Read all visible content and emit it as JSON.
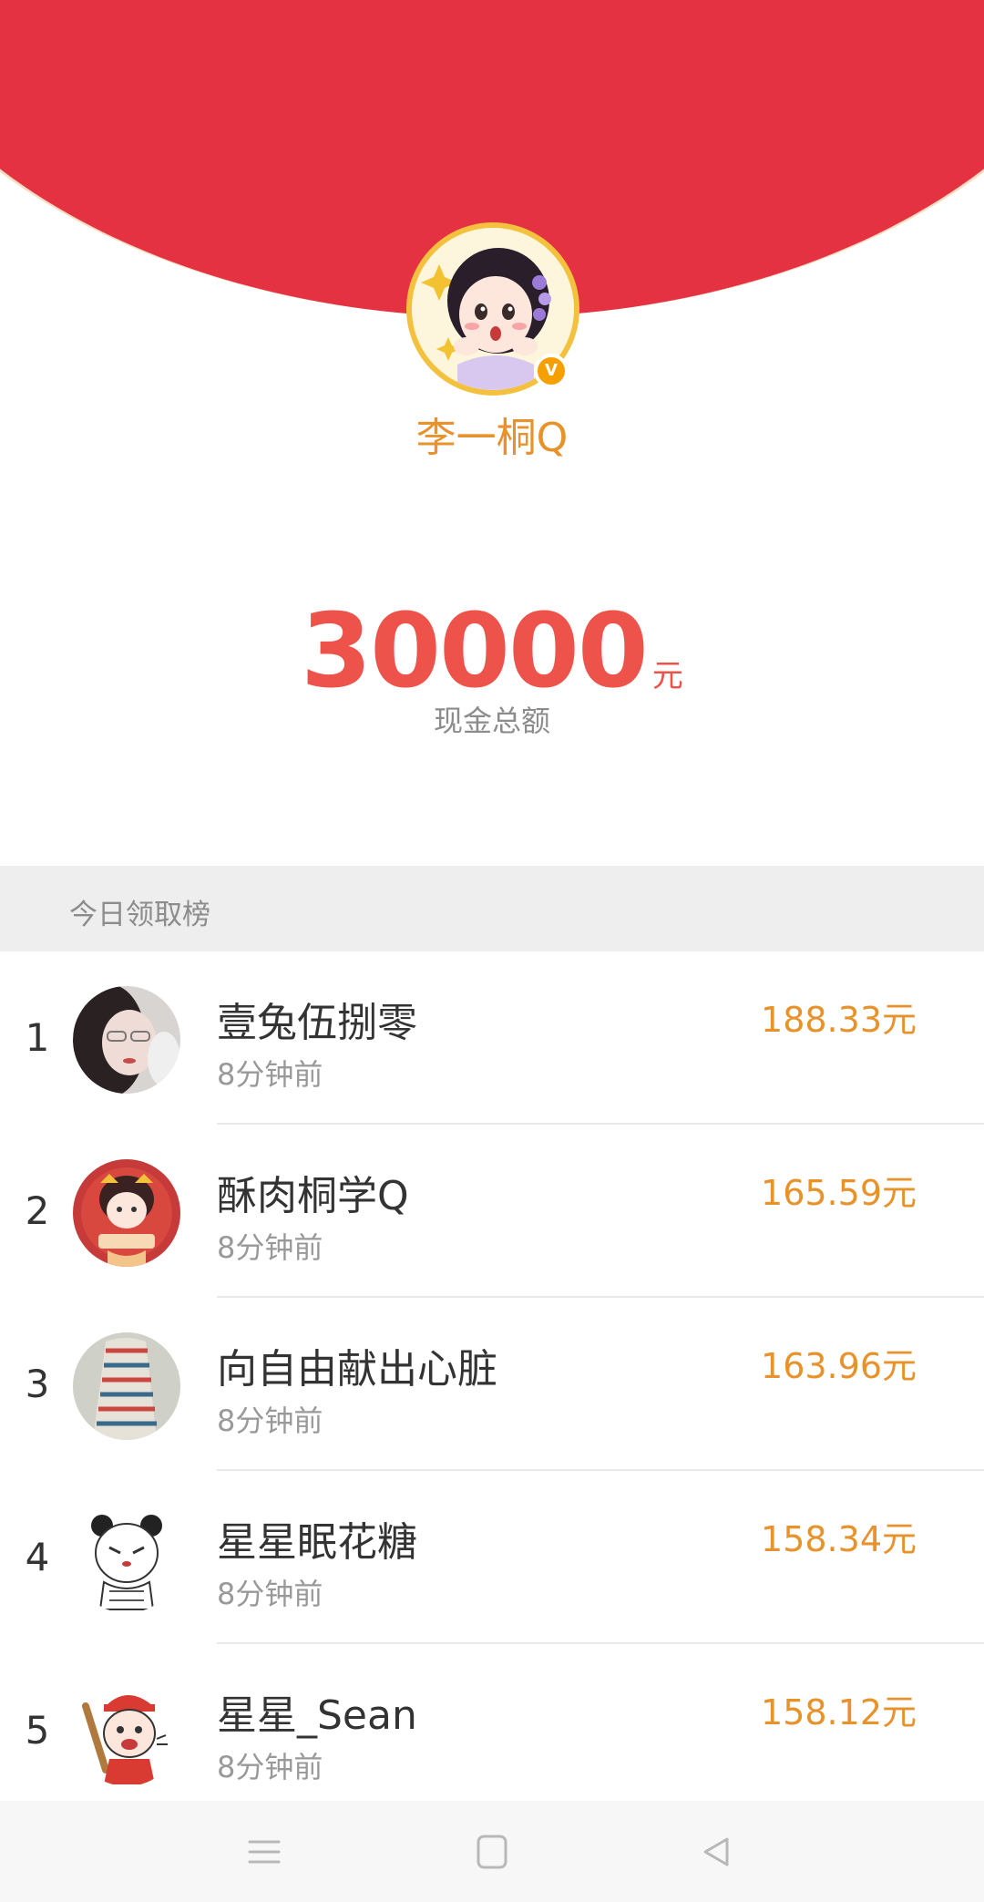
{
  "header": {
    "colors": {
      "red": "#e53242",
      "rim": "#f6dcc0",
      "gold": "#f4c13f"
    }
  },
  "profile": {
    "avatar_icon": "cartoon-girl-avatar",
    "verified_badge": "V",
    "name": "李一桐Q"
  },
  "summary": {
    "amount": "30000",
    "unit": "元",
    "caption": "现金总额"
  },
  "leaderboard": {
    "title": "今日领取榜",
    "rows": [
      {
        "rank": "1",
        "name": "壹兔伍捌零",
        "time": "8分钟前",
        "amount": "188.33元"
      },
      {
        "rank": "2",
        "name": "酥肉桐学Q",
        "time": "8分钟前",
        "amount": "165.59元"
      },
      {
        "rank": "3",
        "name": "向自由献出心脏",
        "time": "8分钟前",
        "amount": "163.96元"
      },
      {
        "rank": "4",
        "name": "星星眠花糖",
        "time": "8分钟前",
        "amount": "158.34元"
      },
      {
        "rank": "5",
        "name": "星星_Sean",
        "time": "8分钟前",
        "amount": "158.12元"
      }
    ]
  },
  "navbar": {
    "menu_icon": "menu-icon",
    "home_icon": "home-icon",
    "back_icon": "back-icon"
  },
  "colors": {
    "amount_red": "#ee534b",
    "gold_text": "#e8922b",
    "muted": "#8c8c8c"
  }
}
